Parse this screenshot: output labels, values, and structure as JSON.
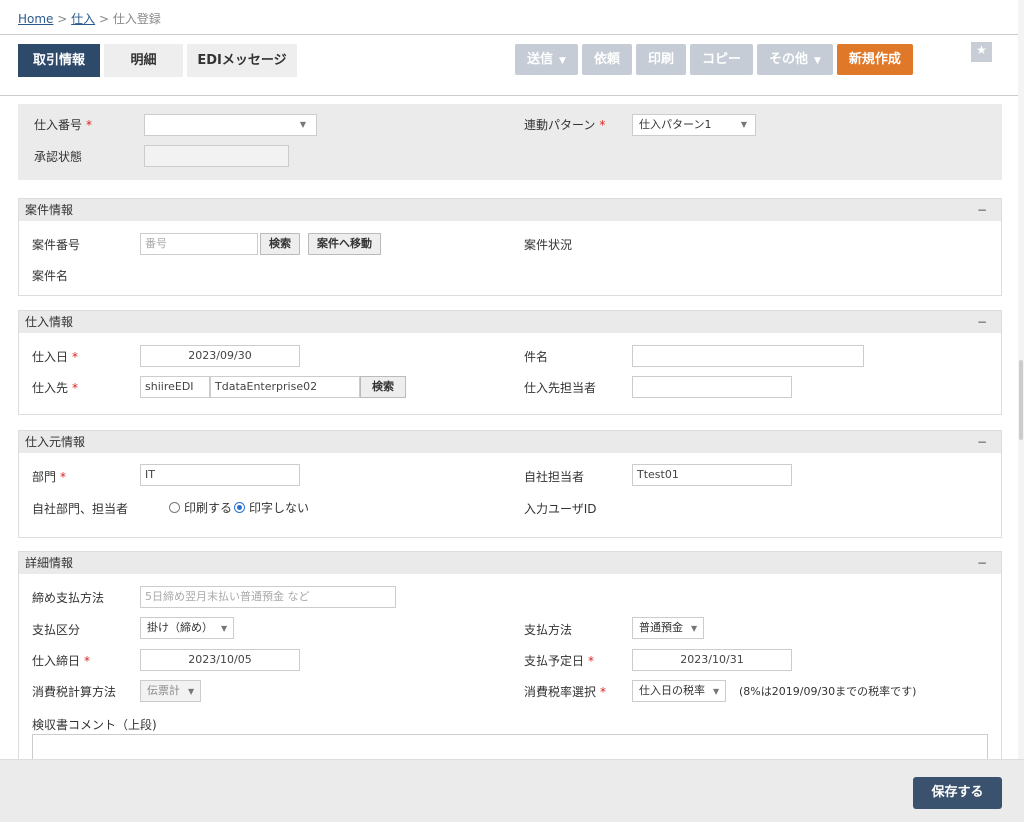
{
  "breadcrumb": {
    "home": "Home",
    "sep": ">",
    "parent": "仕入",
    "current": "仕入登録"
  },
  "tabs": [
    {
      "label": "取引情報"
    },
    {
      "label": "明細"
    },
    {
      "label": "EDIメッセージ"
    }
  ],
  "toolbar": {
    "send": "送信",
    "request": "依頼",
    "print": "印刷",
    "copy": "コピー",
    "other": "その他",
    "new": "新規作成"
  },
  "header": {
    "purchase_no_label": "仕入番号",
    "purchase_no_value": "",
    "approval_label": "承認状態",
    "approval_value": "",
    "link_pattern_label": "連動パターン",
    "link_pattern_value": "仕入パターン1"
  },
  "case_info": {
    "title": "案件情報",
    "case_no_label": "案件番号",
    "case_no_placeholder": "番号",
    "search_btn": "検索",
    "move_btn": "案件へ移動",
    "case_status_label": "案件状況",
    "case_name_label": "案件名"
  },
  "purchase_info": {
    "title": "仕入情報",
    "date_label": "仕入日",
    "date_value": "2023/09/30",
    "subject_label": "件名",
    "subject_value": "",
    "supplier_label": "仕入先",
    "supplier_code": "shiireEDI",
    "supplier_name": "TdataEnterprise02",
    "search_btn": "検索",
    "supplier_person_label": "仕入先担当者",
    "supplier_person_value": ""
  },
  "origin_info": {
    "title": "仕入元情報",
    "dept_label": "部門",
    "dept_value": "IT",
    "own_person_label": "自社担当者",
    "own_person_value": "Ttest01",
    "print_label": "自社部門、担当者",
    "radio_print": "印刷する",
    "radio_noprint": "印字しない",
    "input_user_label": "入力ユーザID"
  },
  "detail_info": {
    "title": "詳細情報",
    "closing_pay_label": "締め支払方法",
    "closing_pay_placeholder": "5日締め翌月末払い普通預金 など",
    "pay_class_label": "支払区分",
    "pay_class_value": "掛け（締め）",
    "pay_method_label": "支払方法",
    "pay_method_value": "普通預金",
    "closing_date_label": "仕入締日",
    "closing_date_value": "2023/10/05",
    "pay_due_label": "支払予定日",
    "pay_due_value": "2023/10/31",
    "tax_calc_label": "消費税計算方法",
    "tax_calc_value": "伝票計",
    "tax_rate_label": "消費税率選択",
    "tax_rate_value": "仕入日の税率",
    "tax_rate_note": "(8%は2019/09/30までの税率です)",
    "comment_label": "検収書コメント（上段)"
  },
  "footer": {
    "save": "保存する"
  },
  "collapse_symbol": "−"
}
